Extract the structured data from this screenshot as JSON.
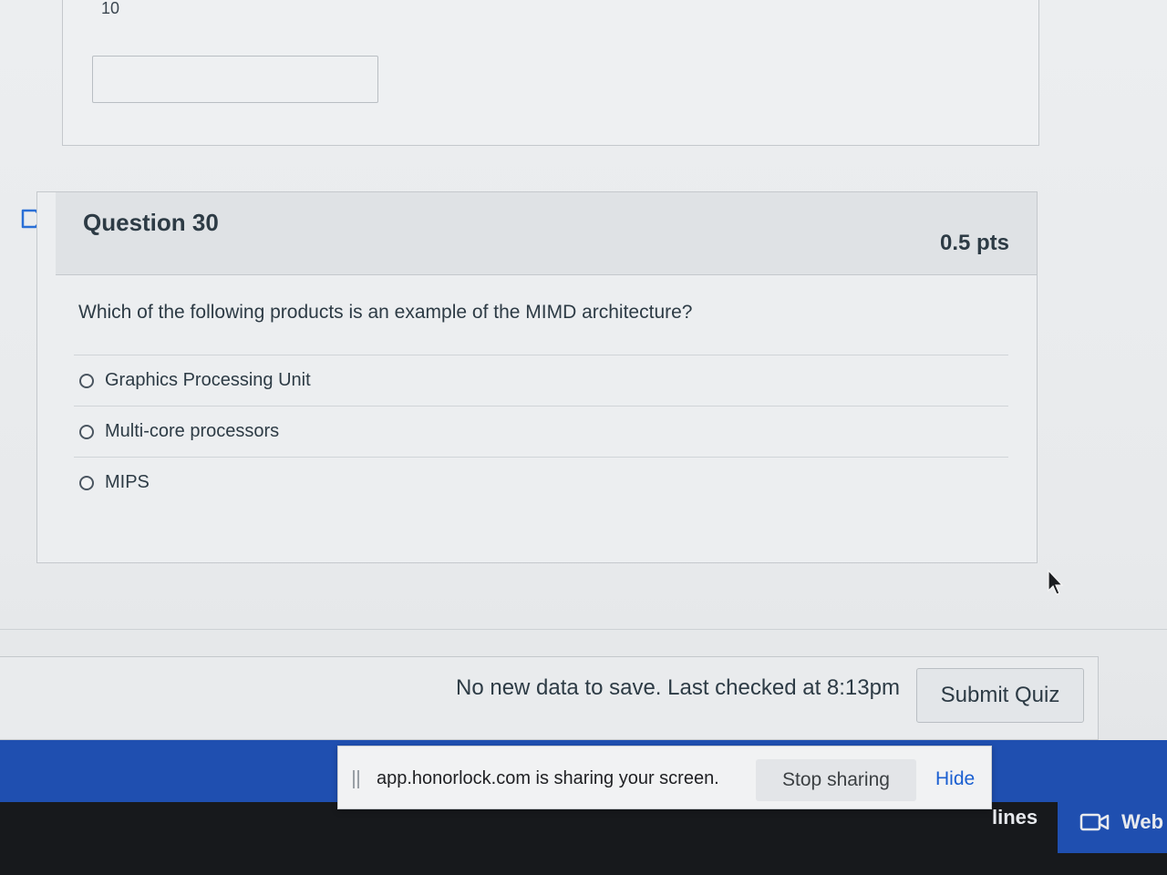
{
  "previous_question": {
    "number_fragment": "10"
  },
  "question": {
    "title": "Question 30",
    "points": "0.5 pts",
    "text": "Which of the following products is an example of the MIMD architecture?",
    "answers": [
      {
        "label": "Graphics Processing Unit"
      },
      {
        "label": "Multi-core processors"
      },
      {
        "label": "MIPS"
      }
    ]
  },
  "footer": {
    "save_status": "No new data to save. Last checked at 8:13pm",
    "submit_label": "Submit Quiz"
  },
  "share_banner": {
    "message": "app.honorlock.com is sharing your screen.",
    "stop_label": "Stop sharing",
    "hide_label": "Hide"
  },
  "bottom_bar": {
    "partial_left_label": "lines",
    "partial_right_label": "Web"
  },
  "colors": {
    "text": "#2d3b45",
    "link": "#1a5fd1",
    "bottom_blue": "#1f4fb0"
  },
  "icons": [
    "flag-icon",
    "radio-icon",
    "drag-handle-icon",
    "camera-icon",
    "cursor-icon"
  ]
}
